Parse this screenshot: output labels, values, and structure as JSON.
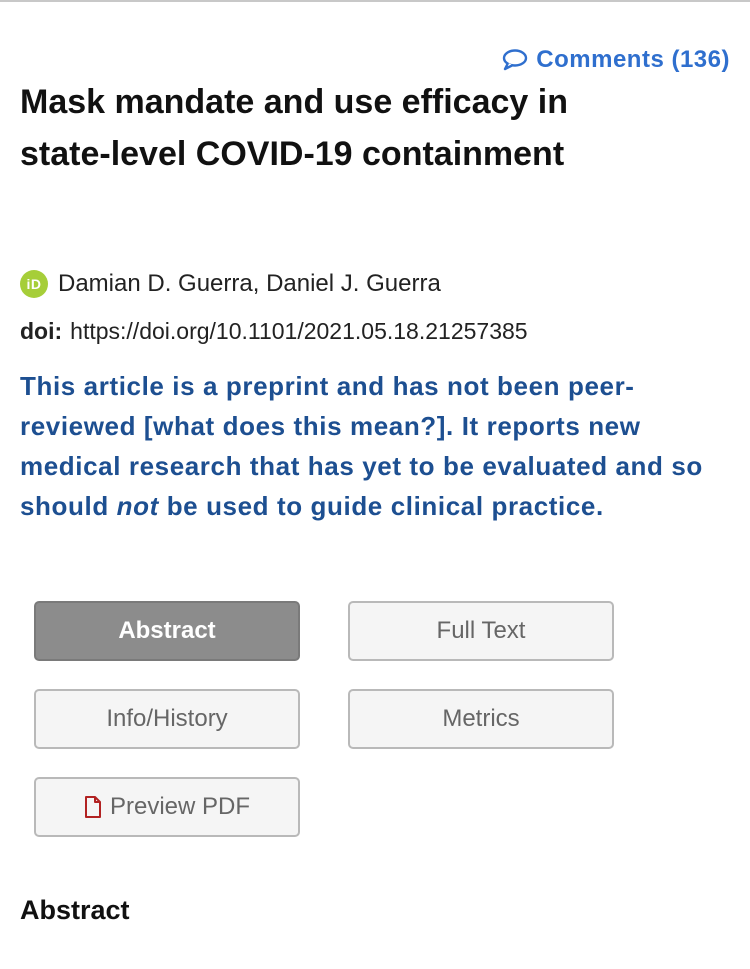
{
  "comments": {
    "label": "Comments (136)",
    "icon": "speech-bubble-icon",
    "color": "#2f6fce"
  },
  "article": {
    "title": "Mask mandate and use efficacy in state-level COVID-19 containment",
    "authors": "Damian D. Guerra, Daniel J. Guerra",
    "orcid_label": "iD",
    "doi_label": "doi:",
    "doi_url": "https://doi.org/10.1101/2021.05.18.21257385"
  },
  "notice": {
    "part1": "This article is a preprint and has not been peer-reviewed ",
    "link": "[what does this mean?]",
    "part2": ". It reports new medical research that has yet to be evaluated and so should ",
    "emphasis": "not",
    "part3": " be used to guide clinical practice.",
    "color": "#1d4f91"
  },
  "tabs": {
    "abstract": "Abstract",
    "full_text": "Full Text",
    "info_history": "Info/History",
    "metrics": "Metrics",
    "preview_pdf": "Preview PDF",
    "active": "Abstract"
  },
  "section": {
    "heading": "Abstract"
  }
}
